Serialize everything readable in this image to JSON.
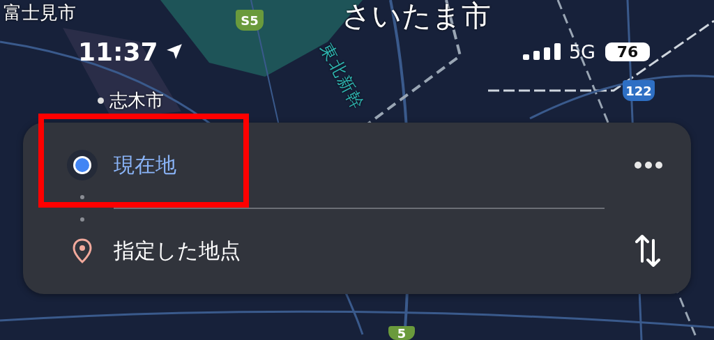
{
  "status_bar": {
    "time": "11:37",
    "network": "5G",
    "battery": "76"
  },
  "map": {
    "labels": [
      {
        "kind": "city",
        "text": "富士見市"
      },
      {
        "kind": "city-dot",
        "text": "志木市"
      },
      {
        "kind": "big-city",
        "text": "さいたま市"
      },
      {
        "kind": "rail",
        "text": "東北新幹"
      }
    ],
    "road_shields": [
      {
        "label": "S5",
        "color": "#6a9a3c"
      },
      {
        "label": "122",
        "color": "#2e6fc4"
      },
      {
        "label": "5",
        "color": "#6a9a3c"
      }
    ]
  },
  "directions_card": {
    "origin": {
      "label": "現在地",
      "highlighted": true
    },
    "destination": {
      "label": "指定した地点",
      "highlighted": false
    }
  }
}
